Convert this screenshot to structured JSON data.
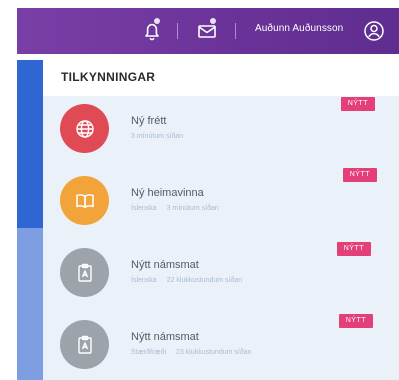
{
  "topbar": {
    "username": "Auðunn Auðunsson",
    "icons": [
      "bell-icon",
      "mail-icon",
      "user-circle-icon"
    ]
  },
  "section": {
    "title": "TILKYNNINGAR"
  },
  "notifications": [
    {
      "title": "Ný frétt",
      "meta": "",
      "time": "3 mínútum síðan",
      "badge": "NÝTT",
      "icon": "globe-icon",
      "color": "#e04a55"
    },
    {
      "title": "Ný heimavinna",
      "meta": "Íslenska",
      "time": "3 mínútum síðan",
      "badge": "NÝTT",
      "icon": "book-icon",
      "color": "#f2a43a"
    },
    {
      "title": "Nýtt námsmat",
      "meta": "Íslenska",
      "time": "22 klukkustundum síðan",
      "badge": "NÝTT",
      "icon": "clipboard-icon",
      "color": "#9da3aa"
    },
    {
      "title": "Nýtt námsmat",
      "meta": "Stærðfræði",
      "time": "23 klukkustundum síðan",
      "badge": "NÝTT",
      "icon": "clipboard-icon",
      "color": "#9da3aa"
    }
  ],
  "colors": {
    "topbar": "#6b3399",
    "rail_active": "#2f66d1",
    "rail_inactive": "#7d9ee0",
    "badge": "#e3407a",
    "list_bg": "#eaf1f8"
  }
}
